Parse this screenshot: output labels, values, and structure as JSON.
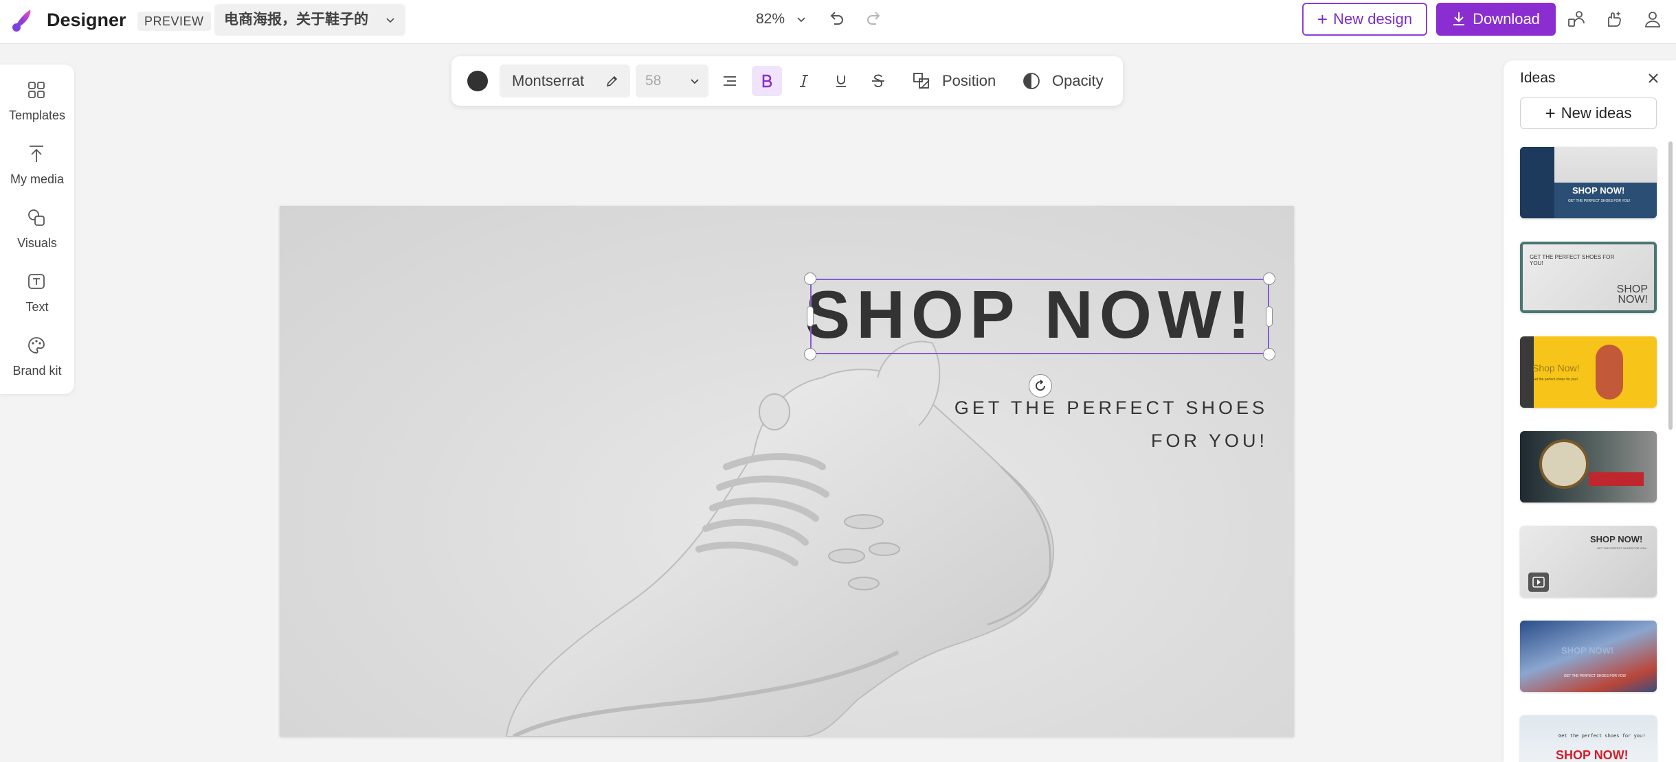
{
  "app": {
    "name": "Designer",
    "badge": "PREVIEW",
    "document_title": "电商海报，关于鞋子的",
    "zoom": "82%",
    "new_design_label": "New design",
    "download_label": "Download",
    "brand_color": "#8b2ed1"
  },
  "left_rail": {
    "items": [
      {
        "label": "Templates",
        "icon": "templates-icon"
      },
      {
        "label": "My media",
        "icon": "upload-icon"
      },
      {
        "label": "Visuals",
        "icon": "visuals-icon"
      },
      {
        "label": "Text",
        "icon": "text-icon"
      },
      {
        "label": "Brand kit",
        "icon": "palette-icon"
      }
    ]
  },
  "toolbar": {
    "text_color": "#323232",
    "font_family": "Montserrat",
    "font_size": "58",
    "bold_active": true,
    "position_label": "Position",
    "opacity_label": "Opacity"
  },
  "canvas": {
    "headline": "SHOP NOW!",
    "subtitle": "GET THE PERFECT SHOES FOR YOU!"
  },
  "ideas": {
    "title": "Ideas",
    "new_ideas_label": "New ideas",
    "thumbnails": [
      {
        "text": "SHOP NOW!",
        "sub": "GET THE PERFECT SHOES FOR YOU!"
      },
      {
        "text": "SHOP NOW!",
        "sub": "GET THE PERFECT SHOES FOR YOU!"
      },
      {
        "text": "Shop Now!",
        "sub": "Get the perfect shoes for you!"
      },
      {
        "text": "",
        "sub": ""
      },
      {
        "text": "SHOP NOW!",
        "sub": "GET THE PERFECT SHOES FOR YOU!"
      },
      {
        "text": "SHOP NOW!",
        "sub": "GET THE PERFECT SHOES FOR YOU!"
      },
      {
        "text": "SHOP NOW!",
        "sub": "Get the perfect shoes for you!"
      }
    ]
  }
}
